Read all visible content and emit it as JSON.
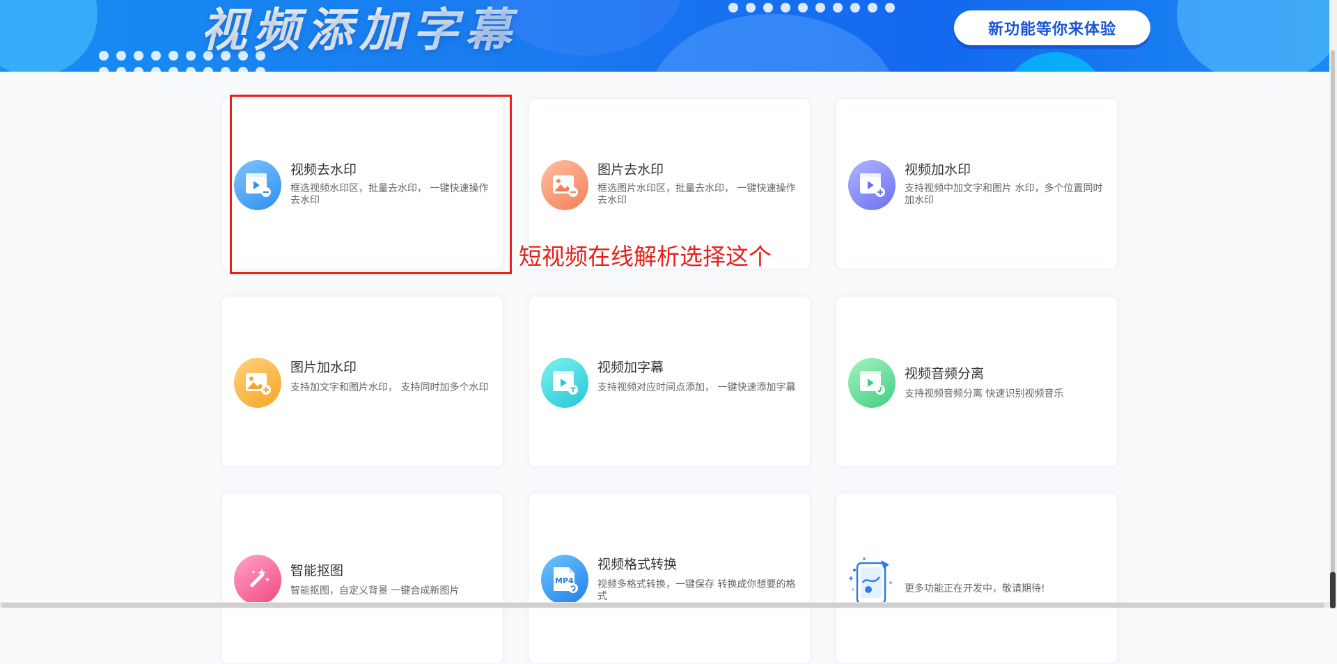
{
  "banner": {
    "title": "视频添加字幕",
    "cta_label": "新功能等你来体验"
  },
  "cards": [
    {
      "title": "视频去水印",
      "desc": "框选视频水印区，批量去水印， 一键快速操作去水印",
      "icon": "video-minus-icon",
      "color": "#2d8ff0"
    },
    {
      "title": "图片去水印",
      "desc": "框选图片水印区，批量去水印， 一键快速操作去水印",
      "icon": "image-minus-icon",
      "color": "#f47f59"
    },
    {
      "title": "视频加水印",
      "desc": "支持视频中加文字和图片 水印，多个位置同时加水印",
      "icon": "video-plus-icon",
      "color": "#6a6ff2"
    },
    {
      "title": "图片加水印",
      "desc": "支持加文字和图片水印， 支持同时加多个水印",
      "icon": "image-plus-icon",
      "color": "#f6a52b"
    },
    {
      "title": "视频加字幕",
      "desc": "支持视频对应时间点添加， 一键快速添加字幕",
      "icon": "video-text-icon",
      "color": "#25c7d6"
    },
    {
      "title": "视频音频分离",
      "desc": "支持视频音频分离 快速识别视频音乐",
      "icon": "video-music-icon",
      "color": "#3fcf82"
    },
    {
      "title": "智能抠图",
      "desc": "智能抠图，自定义背景 一键合成新图片",
      "icon": "magic-wand-icon",
      "color": "#f2487f"
    },
    {
      "title": "视频格式转换",
      "desc": "视频多格式转换，一键保存 转换成你想要的格式",
      "icon": "mp4-file-icon",
      "color": "#1f7ee8",
      "badge": "MP4"
    },
    {
      "title": "",
      "desc": "更多功能正在开发中，敬请期待!",
      "icon": "phone-illustration-icon",
      "color": "#2d8ff0"
    }
  ],
  "annotation": {
    "text": "短视频在线解析选择这个",
    "color": "#e8201a"
  }
}
